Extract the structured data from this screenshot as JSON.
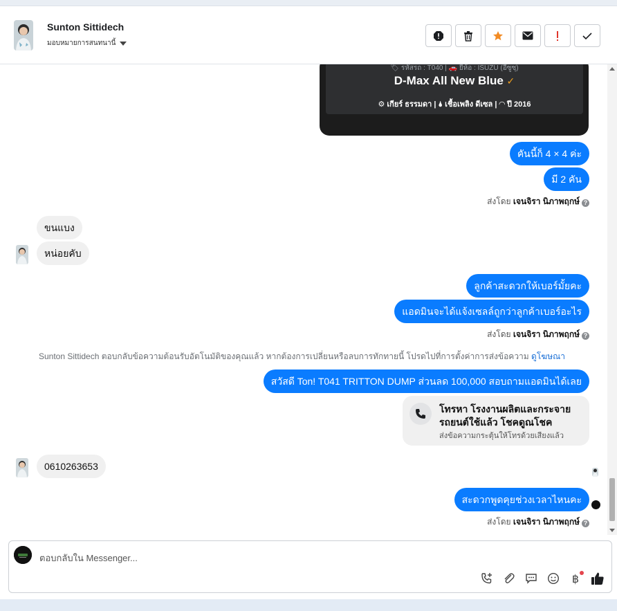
{
  "header": {
    "name": "Sunton Sittidech",
    "assign_label": "มอบหมายการสนทนานี้"
  },
  "actions": [
    {
      "icon": "alert-circle-icon"
    },
    {
      "icon": "trash-icon"
    },
    {
      "icon": "star-icon",
      "color": "#f28b24"
    },
    {
      "icon": "envelope-icon"
    },
    {
      "icon": "exclamation-icon",
      "color": "#e0352b"
    },
    {
      "icon": "checkmark-icon"
    }
  ],
  "card": {
    "line1": "🏷 รหัสรถ : T040 | 🚗 ยี่ห้อ : ISUZU (อีซูซุ)",
    "title": "D-Max All New Blue",
    "specs": "⚙ เกียร์ ธรรมดา  |  🌢 เชื้อเพลิง ดีเซล  |  ◠ ปี 2016"
  },
  "messages": {
    "out1": "คันนี้ก็ 4 × 4  ค่ะ",
    "out2": "มี 2 คัน",
    "in1": "ขนแบง",
    "in2": "หน่อยคับ",
    "out3": "ลูกค้าสะดวกให้เบอร์มั้ยคะ",
    "out4": "แอดมินจะได้แจ้งเซลล์ถูกว่าลูกค้าเบอร์อะไร",
    "out5": "สวัสดี Ton! T041 TRITTON DUMP ส่วนลด 100,000 สอบถามแอดมินได้เลย",
    "in3": "0610263653",
    "out6": "สะดวกพูดคุยช่วงเวลาไหนคะ"
  },
  "sent_by": {
    "prefix": "ส่งโดย",
    "agent": "เจนจิรา นิภาพฤกษ์"
  },
  "system_message": {
    "text": "Sunton Sittidech ตอบกลับข้อความต้อนรับอัตโนมัติของคุณแล้ว หากต้องการเปลี่ยนหรือลบการทักทายนี้ โปรดไปที่การตั้งค่าการส่งข้อความ",
    "link": "ดูโฆษณา"
  },
  "call_card": {
    "title": "โทรหา โรงงานผลิตและกระจายรถยนต์ใช้แล้ว โชคดูณโชค",
    "subtitle": "ส่งข้อความกระตุ้นให้โทรด้วยเสียงแล้ว"
  },
  "composer": {
    "placeholder": "ตอบกลับใน Messenger..."
  },
  "colors": {
    "outgoing_bubble": "#0a7cff",
    "incoming_bubble": "#f0f0f0",
    "like": "#1c1e21"
  }
}
